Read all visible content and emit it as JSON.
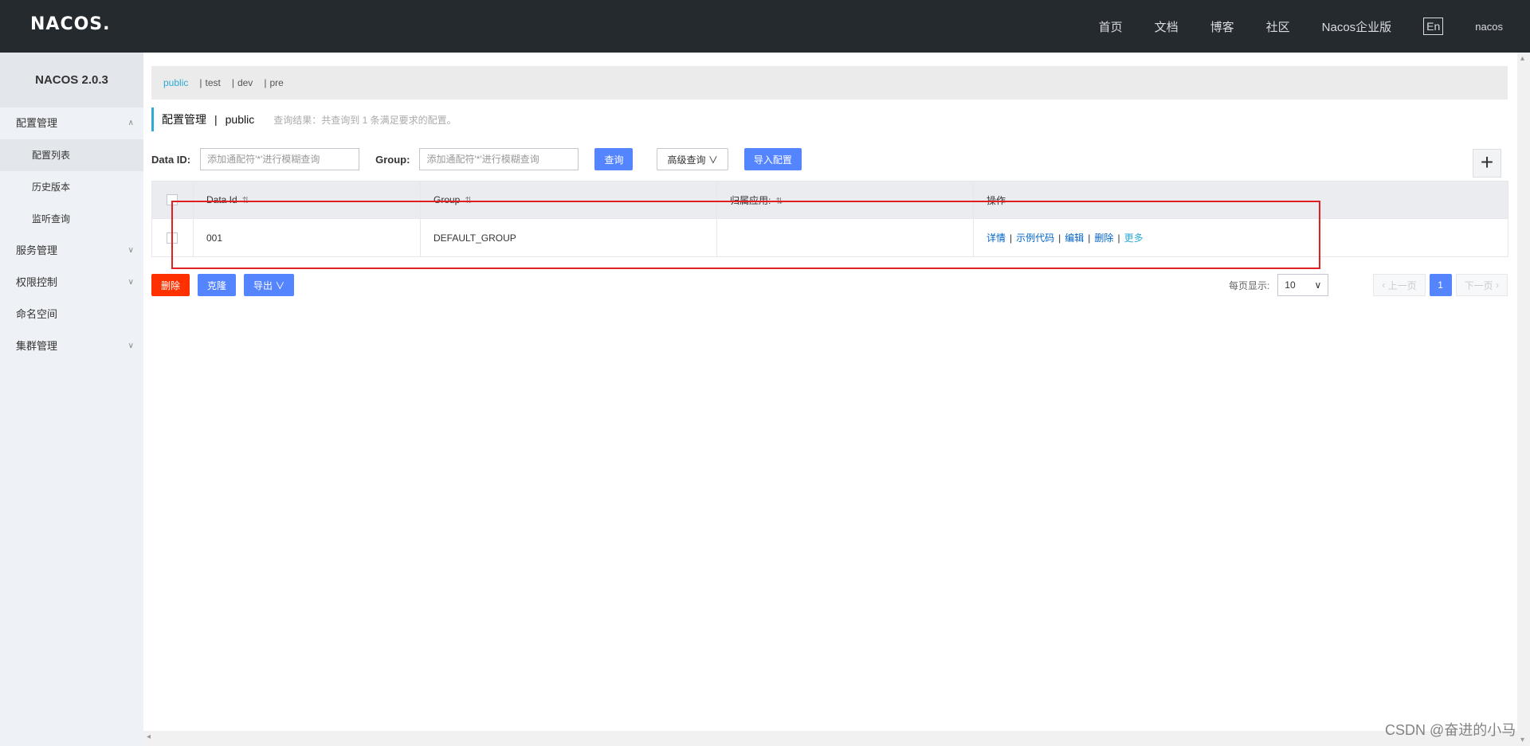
{
  "topbar": {
    "logo": "NACOS.",
    "nav": [
      "首页",
      "文档",
      "博客",
      "社区",
      "Nacos企业版"
    ],
    "lang": "En",
    "user": "nacos"
  },
  "sidebar": {
    "version": "NACOS 2.0.3",
    "groups": [
      {
        "label": "配置管理",
        "expanded": true,
        "items": [
          "配置列表",
          "历史版本",
          "监听查询"
        ]
      },
      {
        "label": "服务管理",
        "expanded": false
      },
      {
        "label": "权限控制",
        "expanded": false
      },
      {
        "label": "命名空间"
      },
      {
        "label": "集群管理",
        "expanded": false
      }
    ]
  },
  "namespaces": {
    "items": [
      "public",
      "test",
      "dev",
      "pre"
    ],
    "active": "public"
  },
  "page_head": {
    "title": "配置管理",
    "namespace": "public",
    "result": "查询结果：共查询到 1 条满足要求的配置。"
  },
  "filters": {
    "data_id_label": "Data ID:",
    "data_id_placeholder": "添加通配符'*'进行模糊查询",
    "group_label": "Group:",
    "group_placeholder": "添加通配符'*'进行模糊查询",
    "query_btn": "查询",
    "advanced_btn": "高级查询",
    "import_btn": "导入配置",
    "add_btn": "+"
  },
  "table": {
    "headers": [
      "Data Id",
      "Group",
      "归属应用:",
      "操作"
    ],
    "rows": [
      {
        "data_id": "001",
        "group": "DEFAULT_GROUP",
        "app": "",
        "ops": [
          "详情",
          "示例代码",
          "编辑",
          "删除",
          "更多"
        ]
      }
    ]
  },
  "bottom": {
    "delete_btn": "删除",
    "clone_btn": "克隆",
    "export_btn": "导出"
  },
  "pager": {
    "label": "每页显示:",
    "page_size": "10",
    "prev": "上一页",
    "current": "1",
    "next": "下一页"
  },
  "watermark": "CSDN @奋进的小马",
  "colors": {
    "accent": "#2ea8d6",
    "primary": "#5584ff",
    "danger": "#ff3000",
    "highlight": "#e02020"
  }
}
